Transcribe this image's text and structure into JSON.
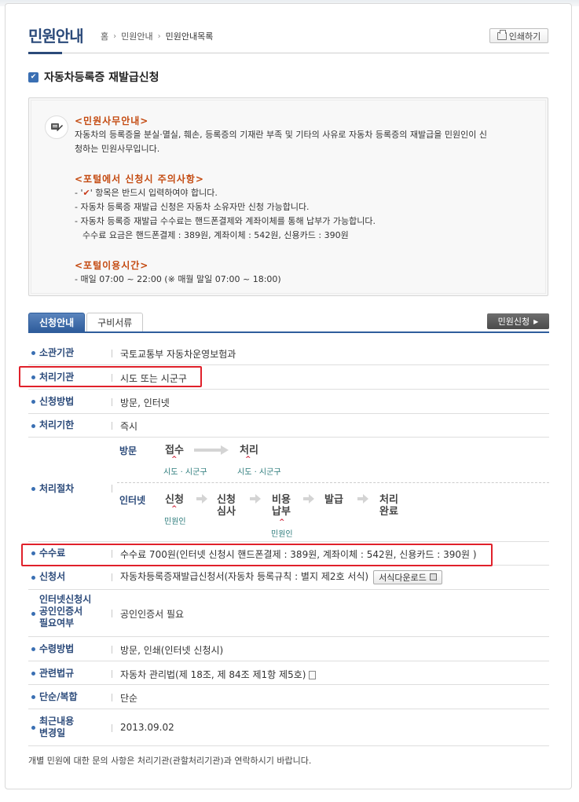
{
  "header": {
    "title": "민원안내",
    "breadcrumb": [
      "홈",
      "민원안내",
      "민원안내목록"
    ],
    "print_label": "인쇄하기"
  },
  "section_title": "자동차등록증 재발급신청",
  "info": {
    "h1": "<민원사무안내>",
    "p1_line1": "자동차의 등록증을 분실·멸실, 훼손, 등록증의 기재란 부족 및 기타의 사유로 자동차 등록증의 재발급을 민원인이 신",
    "p1_line2": "청하는 민원사무입니다.",
    "h2": "<포털에서 신청시 주의사항>",
    "n1_pre": "- '",
    "n1_glyph": "✔",
    "n1_post": "' 항목은 반드시 입력하여야 합니다.",
    "n2": "- 자동차 등록증 재발급 신청은 자동차 소유자만 신청 가능합니다.",
    "n3": "- 자동차 등록증 재발급 수수료는 핸드폰결제와 계좌이체를 통해 납부가 가능합니다.",
    "n4": "수수료 요금은 핸드폰결제 : 389원, 계좌이체 : 542원, 신용카드 : 390원",
    "h3": "<포털이용시간>",
    "n5": "- 매일 07:00 ~ 22:00 (※ 매월 말일 07:00 ~ 18:00)"
  },
  "tabs": [
    "신청안내",
    "구비서류"
  ],
  "apply_label": "민원신청",
  "rows": {
    "agency": {
      "label": "소관기관",
      "value": "국토교통부 자동차운영보험과"
    },
    "processing_agency": {
      "label": "처리기관",
      "value": "시도 또는 시군구"
    },
    "method": {
      "label": "신청방법",
      "value": "방문, 인터넷"
    },
    "deadline": {
      "label": "처리기한",
      "value": "즉시"
    },
    "procedure": {
      "label": "처리절차"
    },
    "fee": {
      "label": "수수료",
      "value": "수수료 700원(인터넷 신청시 핸드폰결제 : 389원, 계좌이체 : 542원, 신용카드 : 390원 )"
    },
    "form": {
      "label": "신청서",
      "value": "자동차등록증재발급신청서(자동차 등록규칙 : 별지 제2호 서식)",
      "download_label": "서식다운로드"
    },
    "cert": {
      "label1": "인터넷신청시",
      "label2": "공인인증서",
      "label3": "필요여부",
      "value": "공인인증서 필요"
    },
    "receive": {
      "label": "수령방법",
      "value": "방문, 인쇄(인터넷 신청시)"
    },
    "law": {
      "label": "관련법규",
      "value": "자동차 관리법(제 18조, 제 84조 제1항 제5호)"
    },
    "type": {
      "label": "단순/복합",
      "value": "단순"
    },
    "updated": {
      "label1": "최근내용",
      "label2": "변경일",
      "value": "2013.09.02"
    }
  },
  "procedure": {
    "visit": {
      "label": "방문",
      "steps": [
        "접수",
        "처리"
      ],
      "subs": [
        "시도 · 시군구",
        "시도 · 시군구"
      ]
    },
    "internet": {
      "label": "인터넷",
      "step1": "신청",
      "step2a": "신청",
      "step2b": "심사",
      "step3a": "비용",
      "step3b": "납부",
      "step4": "발급",
      "step5a": "처리",
      "step5b": "완료",
      "sub1": "민원인",
      "sub3": "민원인"
    }
  },
  "footer": "개별 민원에 대한 문의 사항은 처리기관(관할처리기관)과 연락하시기 바랍니다.",
  "colors": {
    "accent": "#2b4a7a",
    "highlight": "#e0212b",
    "heading_orange": "#c44a10"
  }
}
